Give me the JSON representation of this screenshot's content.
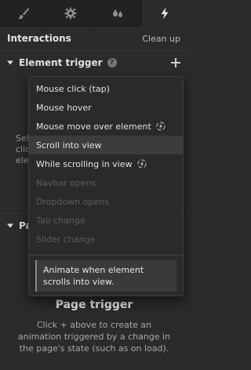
{
  "tabs": [
    {
      "icon": "paintbrush-icon",
      "active": false
    },
    {
      "icon": "gear-icon",
      "active": false
    },
    {
      "icon": "droplets-icon",
      "active": false
    },
    {
      "icon": "lightning-icon",
      "active": true
    }
  ],
  "panel": {
    "title": "Interactions",
    "cleanup_label": "Clean up"
  },
  "element_trigger": {
    "label": "Element trigger",
    "help_glyph": "?",
    "partial_lines": [
      "Sel",
      "clic",
      "ele"
    ]
  },
  "page_trigger": {
    "section_label_partial": "Pa",
    "title": "Page trigger",
    "description": "Click + above to create an animation triggered by a change in the page's state (such as on load)."
  },
  "dropdown": {
    "items": [
      {
        "label": "Mouse click (tap)",
        "disabled": false,
        "highlight": false,
        "bolt": false
      },
      {
        "label": "Mouse hover",
        "disabled": false,
        "highlight": false,
        "bolt": false
      },
      {
        "label": "Mouse move over element",
        "disabled": false,
        "highlight": false,
        "bolt": true
      },
      {
        "label": "Scroll into view",
        "disabled": false,
        "highlight": true,
        "bolt": false
      },
      {
        "label": "While scrolling in view",
        "disabled": false,
        "highlight": false,
        "bolt": true
      },
      {
        "label": "Navbar opens",
        "disabled": true,
        "highlight": false,
        "bolt": false
      },
      {
        "label": "Dropdown opens",
        "disabled": true,
        "highlight": false,
        "bolt": false
      },
      {
        "label": "Tab change",
        "disabled": true,
        "highlight": false,
        "bolt": false
      },
      {
        "label": "Slider change",
        "disabled": true,
        "highlight": false,
        "bolt": false
      }
    ],
    "tooltip": "Animate when element scrolls into view."
  },
  "colors": {
    "background": "#2b2b2b",
    "tab_bar": "#222222",
    "menu_highlight": "#3c3c3c",
    "disabled_text": "#5c5c5c"
  }
}
